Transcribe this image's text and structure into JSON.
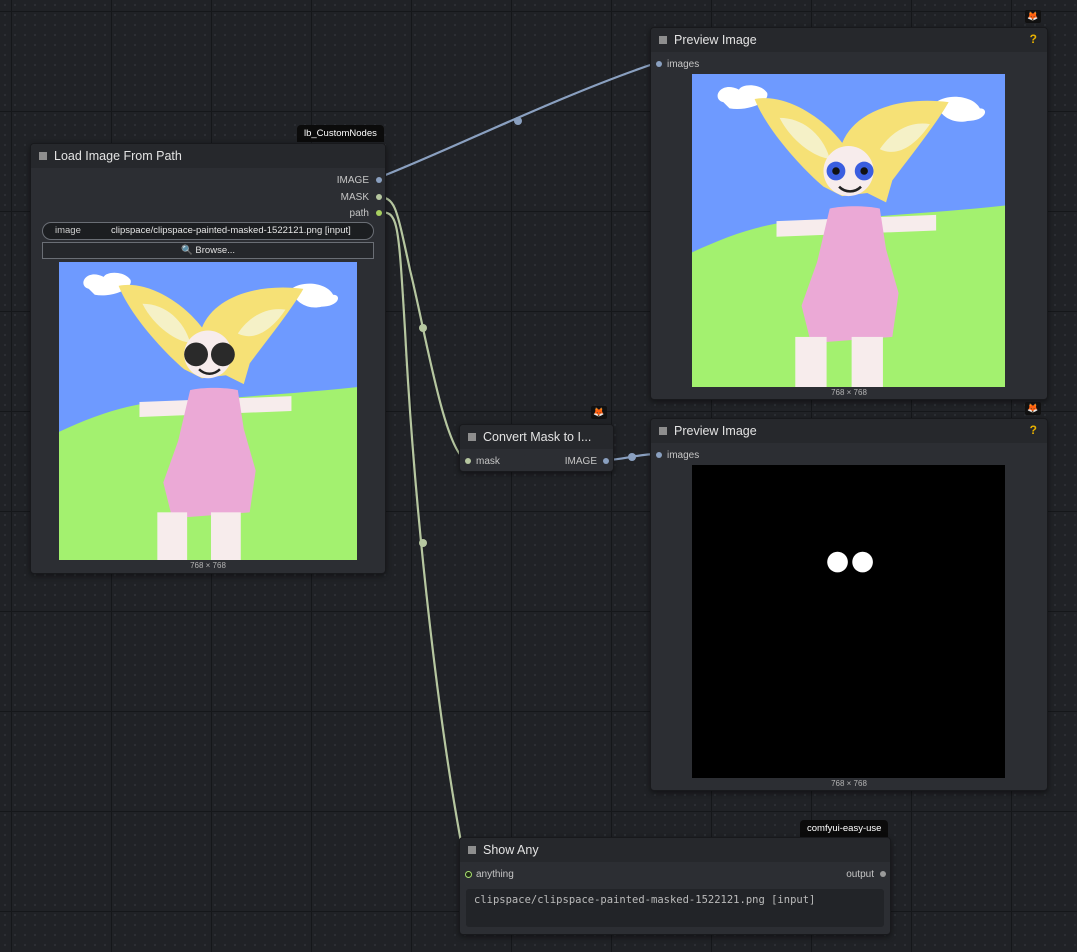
{
  "nodes": {
    "load_image": {
      "badge": "lb_CustomNodes",
      "title": "Load Image From Path",
      "outputs": [
        "IMAGE",
        "MASK",
        "path"
      ],
      "widget_label": "image",
      "widget_value": "clipspace/clipspace-painted-masked-1522121.png [input]",
      "browse_label": "🔍 Browse...",
      "size_caption": "768 × 768"
    },
    "preview_top": {
      "title": "Preview Image",
      "help": "?",
      "input": "images",
      "size_caption": "768 × 768"
    },
    "convert_mask": {
      "title": "Convert Mask to I...",
      "input": "mask",
      "output": "IMAGE"
    },
    "preview_bottom": {
      "title": "Preview Image",
      "help": "?",
      "input": "images",
      "size_caption": "768 × 768"
    },
    "show_any": {
      "badge": "comfyui-easy-use",
      "title": "Show Any",
      "input": "anything",
      "output": "output",
      "text": "clipspace/clipspace-painted-masked-1522121.png [input]"
    }
  },
  "icons": {
    "node_badge": "fox-icon",
    "node_collapse": "square-dot-icon"
  },
  "colors": {
    "canvas": "#202226",
    "node_body": "#2c2e33",
    "node_header": "#26282c",
    "image_link": "#8aa0c0",
    "mask_link": "#b6c7a0",
    "string_link": "#b6c7a0",
    "help": "#e8b100"
  }
}
